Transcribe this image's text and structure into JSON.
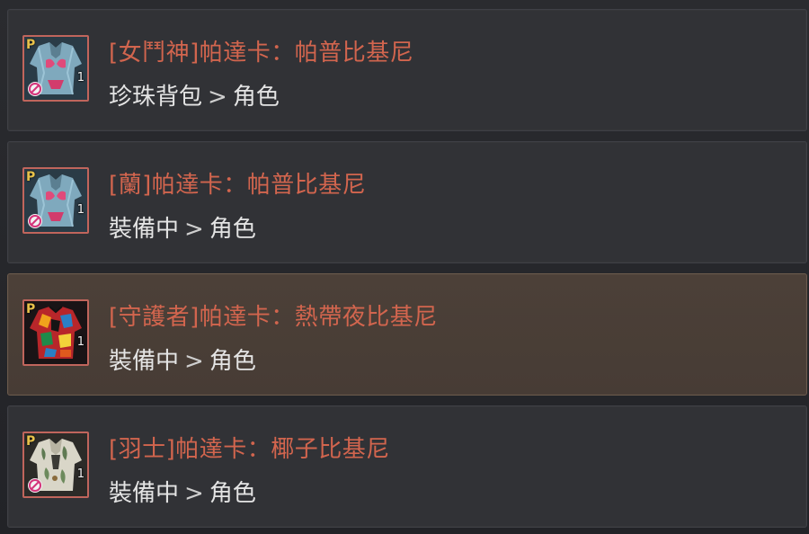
{
  "items": [
    {
      "title": "[女鬥神]帕達卡：帕普比基尼",
      "location_from": "珍珠背包",
      "location_to": "角色",
      "separator": ">",
      "badge": "P",
      "count": "1",
      "icon": "bikini-jacket-blue-icon",
      "selected": false
    },
    {
      "title": "[蘭]帕達卡：帕普比基尼",
      "location_from": "裝備中",
      "location_to": "角色",
      "separator": ">",
      "badge": "P",
      "count": "1",
      "icon": "bikini-jacket-blue-icon",
      "selected": false
    },
    {
      "title": "[守護者]帕達卡：熱帶夜比基尼",
      "location_from": "裝備中",
      "location_to": "角色",
      "separator": ">",
      "badge": "P",
      "count": "1",
      "icon": "tropical-shirt-icon",
      "selected": true
    },
    {
      "title": "[羽士]帕達卡：椰子比基尼",
      "location_from": "裝備中",
      "location_to": "角色",
      "separator": ">",
      "badge": "P",
      "count": "1",
      "icon": "coconut-shirt-icon",
      "selected": false
    }
  ],
  "colors": {
    "title": "#d2654e",
    "location": "#e4e4e4",
    "item_bg": "#313236",
    "selected_bg": "#4c4038",
    "frame": "#c0655c",
    "badge": "#e8c24a"
  }
}
